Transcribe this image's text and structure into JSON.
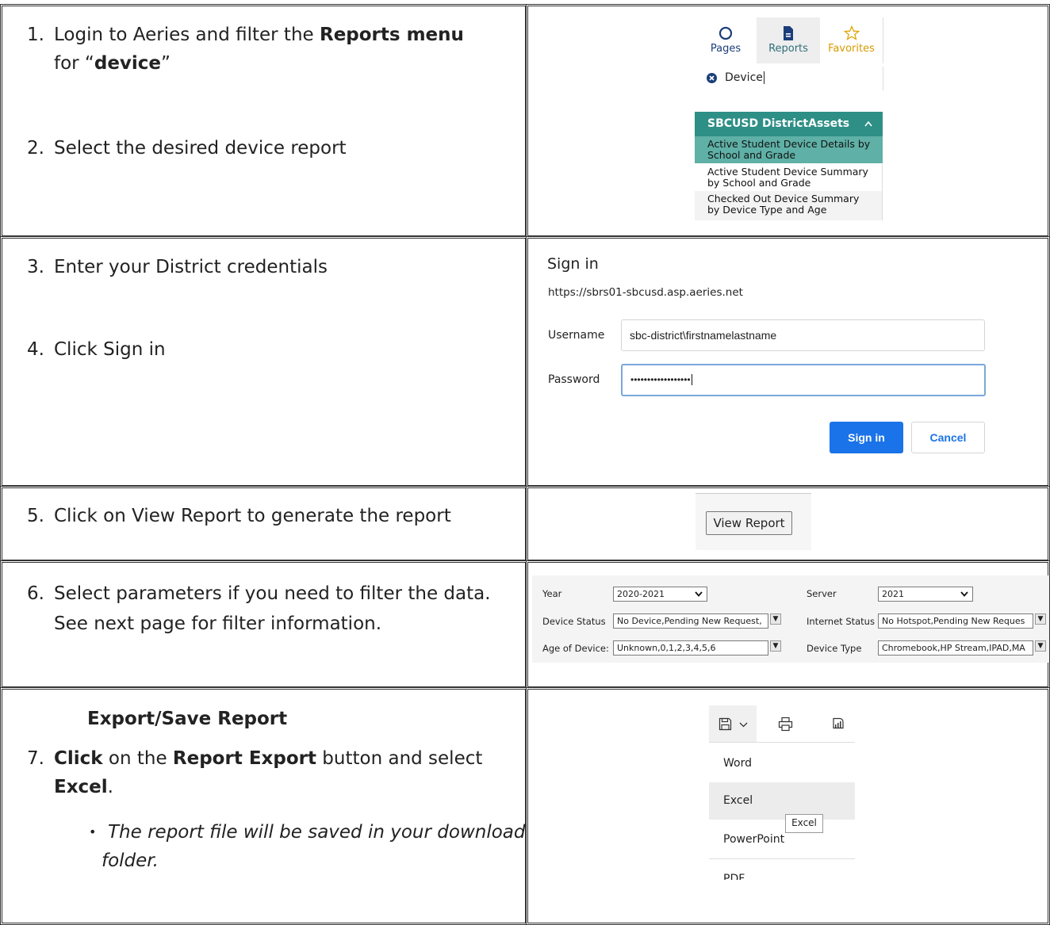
{
  "steps": {
    "s1": {
      "num": "1.",
      "pre": "Login to Aeries and filter the ",
      "bold1": "Reports menu",
      "line2_pre": "for “",
      "bold2": "device",
      "line2_post": "”"
    },
    "s2": {
      "num": "2.",
      "text": "Select the desired device report"
    },
    "s3": {
      "num": "3.",
      "text": "Enter your District credentials"
    },
    "s4": {
      "num": "4.",
      "text": "Click Sign in"
    },
    "s5": {
      "num": "5.",
      "text": "Click on View Report to generate the report"
    },
    "s6": {
      "num": "6.",
      "line1": "Select parameters if you need to filter the data.",
      "line2": "See next page for filter information."
    },
    "export_heading": "Export/Save Report",
    "s7": {
      "num": "7.",
      "b1": "Click",
      "t1": " on the ",
      "b2": "Report Export",
      "t2": " button and select",
      "b3": "Excel",
      "t3": "."
    },
    "bullet": "•",
    "note_line1": "The report file will be saved in your download",
    "note_line2": "folder."
  },
  "aeries_menu": {
    "tabs": [
      "Pages",
      "Reports",
      "Favorites"
    ],
    "filter_value": "Device",
    "group": "SBCUSD DistrictAssets",
    "items": [
      [
        "Active Student Device Details by",
        "School and Grade"
      ],
      [
        "Active Student Device Summary",
        "by School and Grade"
      ],
      [
        "Checked Out Device Summary",
        "by Device Type and Age"
      ]
    ],
    "colors": {
      "accent": "#2e8f86",
      "selected": "#5fb0a6",
      "icon_blue": "#1b3e7a",
      "star": "#e0a400"
    }
  },
  "signin": {
    "title": "Sign in",
    "url": "https://sbrs01-sbcusd.asp.aeries.net",
    "username_label": "Username",
    "username_value": "sbc-district\\firstnamelastname",
    "password_label": "Password",
    "password_value": "••••••••••••••••••",
    "signin_button": "Sign in",
    "cancel_button": "Cancel"
  },
  "view_report": {
    "button": "View Report"
  },
  "params": {
    "year_label": "Year",
    "year_value": "2020-2021",
    "server_label": "Server",
    "server_value": "2021",
    "device_status_label": "Device Status",
    "device_status_value": "No Device,Pending New Request,",
    "internet_status_label": "Internet Status",
    "internet_status_value": "No Hotspot,Pending New Reques",
    "age_label": "Age of Device:",
    "age_value": "Unknown,0,1,2,3,4,5,6",
    "device_type_label": "Device Type",
    "device_type_value": "Chromebook,HP Stream,IPAD,MA"
  },
  "export_menu": {
    "items": [
      "Word",
      "Excel",
      "PowerPoint",
      "PDF"
    ],
    "tooltip": "Excel"
  }
}
